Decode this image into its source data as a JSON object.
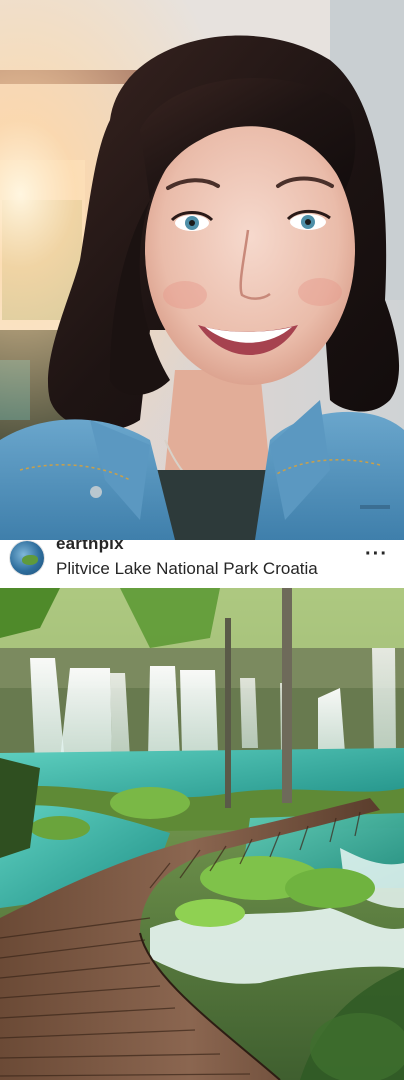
{
  "post": {
    "account_name": "earthpix",
    "location": "Plitvice Lake National Park Croatia",
    "more_label": "···"
  },
  "icons": {
    "avatar": "globe-avatar-icon",
    "more": "more-options-icon"
  },
  "colors": {
    "text": "#262626",
    "background": "#ffffff",
    "water": "#3fb8a8",
    "denim": "#4f8fb8"
  }
}
